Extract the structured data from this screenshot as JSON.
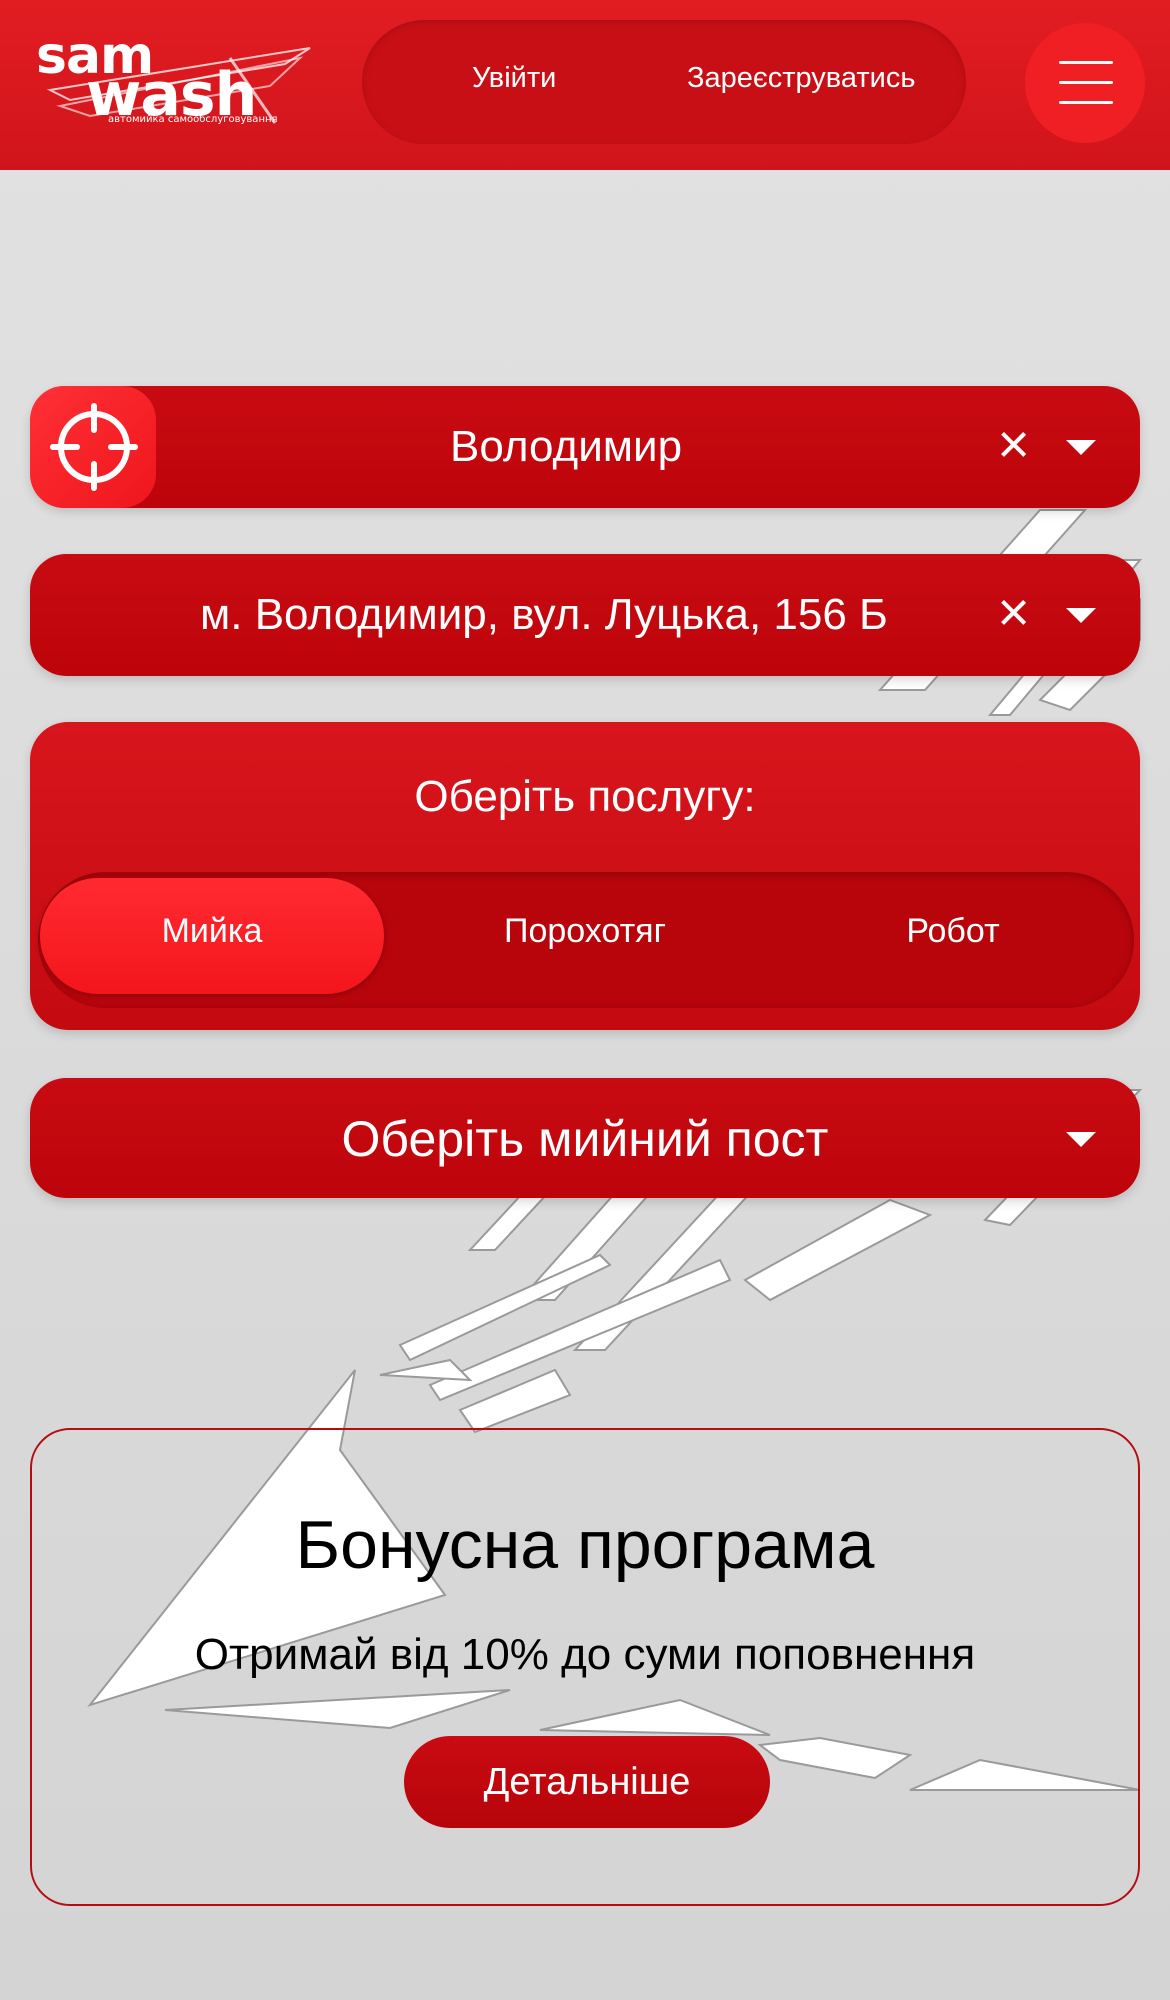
{
  "header": {
    "logo": {
      "top": "sam",
      "bottom": "wash",
      "tagline": "автомийка самообслуговування"
    },
    "login_label": "Увійти",
    "register_label": "Зареєструватись",
    "menu_icon": "hamburger-icon"
  },
  "selectors": {
    "city": {
      "value": "Володимир",
      "locate_icon": "crosshair-icon",
      "clear_icon": "close-icon",
      "caret_icon": "chevron-down-icon"
    },
    "address": {
      "value": "м. Володимир, вул. Луцька, 156 Б",
      "clear_icon": "close-icon",
      "caret_icon": "chevron-down-icon"
    },
    "post": {
      "placeholder": "Оберіть мийний пост",
      "caret_icon": "chevron-down-icon"
    }
  },
  "service": {
    "title": "Оберіть послугу:",
    "options": [
      "Мийка",
      "Порохотяг",
      "Робот"
    ],
    "selected": "Мийка"
  },
  "bonus": {
    "title": "Бонусна програма",
    "subtitle": "Отримай від 10% до суми поповнення",
    "button_label": "Детальніше"
  },
  "colors": {
    "primary": "#c8000a",
    "accent": "#f01f24",
    "background": "#dcdcdc"
  }
}
